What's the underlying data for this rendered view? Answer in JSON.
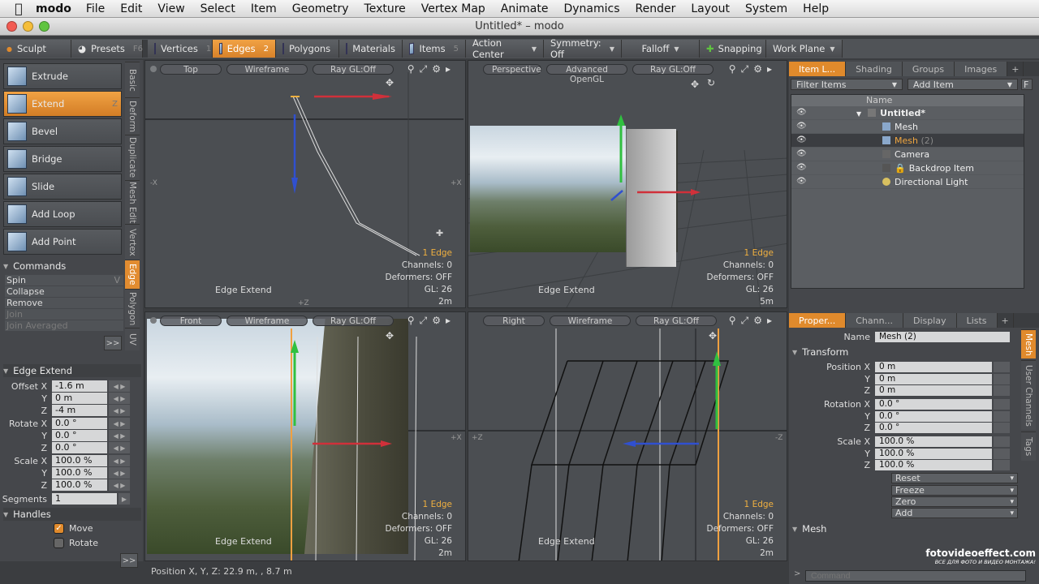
{
  "menubar": {
    "app_name": "modo",
    "items": [
      "File",
      "Edit",
      "View",
      "Select",
      "Item",
      "Geometry",
      "Texture",
      "Vertex Map",
      "Animate",
      "Dynamics",
      "Render",
      "Layout",
      "System",
      "Help"
    ]
  },
  "window": {
    "title": "Untitled* – modo"
  },
  "toolbar": {
    "sculpt": "Sculpt",
    "presets": "Presets",
    "presets_key": "F6",
    "vertices": "Vertices",
    "vertices_num": "1",
    "edges": "Edges",
    "edges_num": "2",
    "polygons": "Polygons",
    "polygons_num": "3",
    "materials": "Materials",
    "items": "Items",
    "items_num": "5",
    "action_center": "Action Center",
    "symmetry": "Symmetry: Off",
    "falloff": "Falloff",
    "snapping": "Snapping",
    "work_plane": "Work Plane"
  },
  "tools": [
    {
      "label": "Extrude",
      "key": ""
    },
    {
      "label": "Extend",
      "key": "Z"
    },
    {
      "label": "Bevel",
      "key": ""
    },
    {
      "label": "Bridge",
      "key": ""
    },
    {
      "label": "Slide",
      "key": ""
    },
    {
      "label": "Add Loop",
      "key": ""
    },
    {
      "label": "Add Point",
      "key": ""
    }
  ],
  "vtabs": [
    "Basic",
    "Deform",
    "Duplicate",
    "Mesh Edit",
    "Vertex",
    "Edge",
    "Polygon",
    "UV"
  ],
  "commands": {
    "title": "Commands",
    "items": [
      "Spin",
      "Collapse",
      "Remove",
      "Join",
      "Join Averaged"
    ],
    "spin_key": "V"
  },
  "more_label": ">>",
  "edge_extend": {
    "title": "Edge Extend",
    "offset_label": "Offset X",
    "offset": [
      "-1.6 m",
      "0 m",
      "-4 m"
    ],
    "rotate_label": "Rotate X",
    "rotate": [
      "0.0 °",
      "0.0 °",
      "0.0 °"
    ],
    "scale_label": "Scale X",
    "scale": [
      "100.0 %",
      "100.0 %",
      "100.0 %"
    ],
    "y_label": "Y",
    "z_label": "Z",
    "segments_label": "Segments",
    "segments": "1"
  },
  "handles": {
    "title": "Handles",
    "move": "Move",
    "rotate": "Rotate"
  },
  "viewports": [
    {
      "view": "Top",
      "shade": "Wireframe",
      "ray": "Ray GL:Off",
      "edges": "1 Edge",
      "channels": "Channels: 0",
      "deformers": "Deformers: OFF",
      "gl": "GL: 26",
      "scale": "2m",
      "label": "Edge Extend"
    },
    {
      "view": "Perspective",
      "shade": "Advanced OpenGL",
      "ray": "Ray GL:Off",
      "edges": "1 Edge",
      "channels": "Channels: 0",
      "deformers": "Deformers: OFF",
      "gl": "GL: 26",
      "scale": "5m",
      "label": "Edge Extend"
    },
    {
      "view": "Front",
      "shade": "Wireframe",
      "ray": "Ray GL:Off",
      "edges": "1 Edge",
      "channels": "Channels: 0",
      "deformers": "Deformers: OFF",
      "gl": "GL: 26",
      "scale": "2m",
      "label": "Edge Extend"
    },
    {
      "view": "Right",
      "shade": "Wireframe",
      "ray": "Ray GL:Off",
      "edges": "1 Edge",
      "channels": "Channels: 0",
      "deformers": "Deformers: OFF",
      "gl": "GL: 26",
      "scale": "2m",
      "label": "Edge Extend"
    }
  ],
  "axis": {
    "x": "X",
    "y": "Y",
    "z": "Z",
    "neg_x": "-X",
    "pos_x": "+X",
    "neg_z": "-Z",
    "pos_z": "+Z"
  },
  "item_list": {
    "tabs": [
      "Item L...",
      "Shading",
      "Groups",
      "Images"
    ],
    "plus": "+",
    "filter": "Filter Items",
    "add_item": "Add Item",
    "f_label": "F",
    "name_header": "Name",
    "rows": [
      {
        "name": "Untitled*",
        "suffix": ""
      },
      {
        "name": "Mesh",
        "suffix": ""
      },
      {
        "name": "Mesh",
        "suffix": " (2)"
      },
      {
        "name": "Camera",
        "suffix": ""
      },
      {
        "name": "Backdrop Item",
        "suffix": ""
      },
      {
        "name": "Directional Light",
        "suffix": ""
      }
    ]
  },
  "properties": {
    "tabs": [
      "Proper...",
      "Chann...",
      "Display",
      "Lists"
    ],
    "name_label": "Name",
    "name_value": "Mesh (2)",
    "transform_title": "Transform",
    "position_label": "Position X",
    "position": [
      "0 m",
      "0 m",
      "0 m"
    ],
    "rotation_label": "Rotation X",
    "rotation": [
      "0.0 °",
      "0.0 °",
      "0.0 °"
    ],
    "scale_label": "Scale X",
    "scale": [
      "100.0 %",
      "100.0 %",
      "100.0 %"
    ],
    "y_label": "Y",
    "z_label": "Z",
    "actions": [
      "Reset",
      "Freeze",
      "Zero",
      "Add"
    ],
    "mesh_title": "Mesh",
    "vtabs": [
      "Mesh",
      "User Channels",
      "Tags"
    ]
  },
  "status": {
    "position": "Position X, Y, Z:   22.9 m, , 8.7 m"
  },
  "command_placeholder": "Command",
  "watermark": {
    "main": "fotovideoeffect.com",
    "sub": "ВСЕ ДЛЯ ФОТО И ВИДЕО МОНТАЖА!"
  },
  "colors": {
    "accent": "#e08a2c",
    "x_axis": "#d0303a",
    "y_axis": "#30c040",
    "z_axis": "#3050d0"
  }
}
